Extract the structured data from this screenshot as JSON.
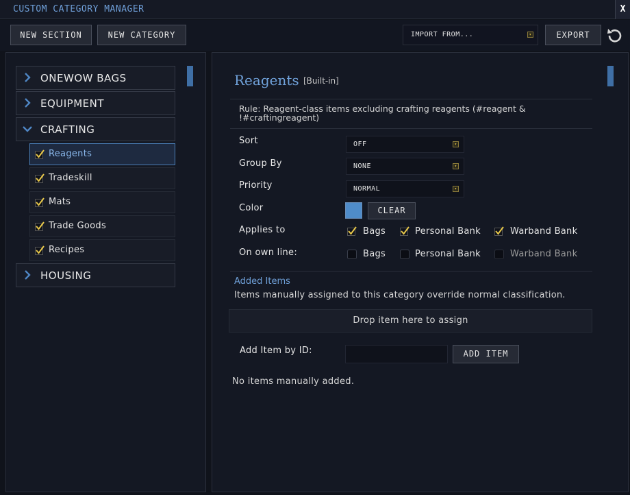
{
  "window": {
    "title": "CUSTOM CATEGORY MANAGER",
    "close_label": "X"
  },
  "toolbar": {
    "new_section_label": "NEW SECTION",
    "new_category_label": "NEW CATEGORY",
    "import_value": "IMPORT FROM...",
    "export_label": "EXPORT",
    "refresh_icon": "refresh-icon"
  },
  "sidebar": {
    "sections": [
      {
        "label": "ONEWOW BAGS",
        "expanded": false
      },
      {
        "label": "EQUIPMENT",
        "expanded": false
      },
      {
        "label": "CRAFTING",
        "expanded": true
      },
      {
        "label": "HOUSING",
        "expanded": false
      }
    ],
    "categories": [
      {
        "label": "Reagents",
        "checked": true,
        "selected": true
      },
      {
        "label": "Tradeskill",
        "checked": true,
        "selected": false
      },
      {
        "label": "Mats",
        "checked": true,
        "selected": false
      },
      {
        "label": "Trade Goods",
        "checked": true,
        "selected": false
      },
      {
        "label": "Recipes",
        "checked": true,
        "selected": false
      }
    ]
  },
  "detail": {
    "title": "Reagents",
    "badge": "[Built-in]",
    "rule_text": "Rule: Reagent-class items excluding crafting reagents (#reagent & !#craftingreagent)",
    "fields": {
      "sort": {
        "label": "Sort",
        "value": "OFF"
      },
      "group_by": {
        "label": "Group By",
        "value": "NONE"
      },
      "priority": {
        "label": "Priority",
        "value": "NORMAL"
      },
      "color": {
        "label": "Color",
        "value": "#4f8cc9",
        "clear_label": "CLEAR"
      },
      "applies_to": {
        "label": "Applies to",
        "options": [
          {
            "label": "Bags",
            "checked": true,
            "enabled": true
          },
          {
            "label": "Personal Bank",
            "checked": true,
            "enabled": true
          },
          {
            "label": "Warband Bank",
            "checked": true,
            "enabled": true
          }
        ]
      },
      "own_line": {
        "label": "On own line:",
        "options": [
          {
            "label": "Bags",
            "checked": false,
            "enabled": true
          },
          {
            "label": "Personal Bank",
            "checked": false,
            "enabled": true
          },
          {
            "label": "Warband Bank",
            "checked": false,
            "enabled": false
          }
        ]
      }
    },
    "added_items": {
      "heading": "Added Items",
      "description": "Items manually assigned to this category override normal classification.",
      "drop_label": "Drop item here to assign",
      "add_by_id_label": "Add Item by ID:",
      "id_input_value": "",
      "add_button_label": "ADD ITEM",
      "empty_text": "No items manually added."
    }
  },
  "colors": {
    "accent": "#6fa0d8",
    "check": "#e8c84a",
    "panel": "#141823"
  }
}
